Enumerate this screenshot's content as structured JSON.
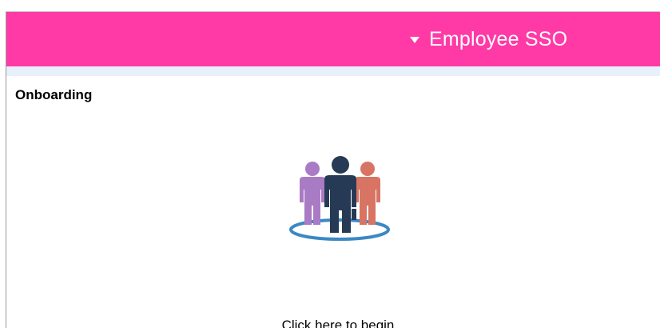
{
  "header": {
    "menu_label": "Employee SSO",
    "menu_icon": "caret-down-icon",
    "background_color": "#ff3aa6"
  },
  "tile": {
    "title": "Onboarding",
    "icon": "team-people-icon",
    "cta_label": "Click here to begin"
  }
}
